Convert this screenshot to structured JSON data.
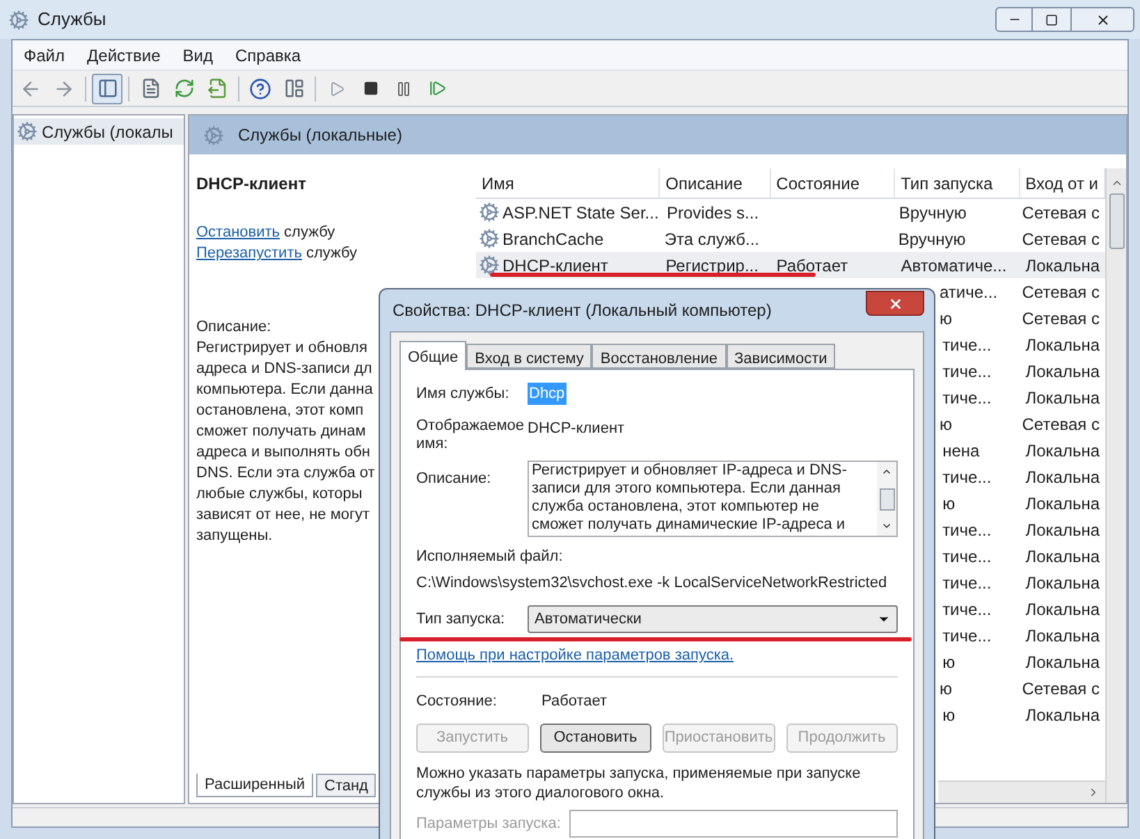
{
  "window": {
    "title": "Службы"
  },
  "menu": [
    "Файл",
    "Действие",
    "Вид",
    "Справка"
  ],
  "tree": [
    {
      "label": "Службы (локалы",
      "selected": true
    }
  ],
  "header": {
    "title": "Службы (локальные)"
  },
  "details": {
    "title": "DHCP-клиент",
    "actions": [
      {
        "link": "Остановить",
        "text": "службу"
      },
      {
        "link": "Перезапустить",
        "text": "службу"
      }
    ],
    "description_label": "Описание:",
    "description_lines": [
      "Регистрирует и обновля",
      "адреса и DNS-записи дл",
      "компьютера. Если данна",
      "остановлена, этот комп",
      "сможет получать динам",
      "адреса и выполнять обн",
      "DNS. Если эта служба от",
      "любые службы, которы",
      "зависят от нее, не могут",
      "запущены."
    ]
  },
  "view_tabs": [
    {
      "label": "Расширенный",
      "selected": true
    },
    {
      "label": "Станд",
      "selected": false
    }
  ],
  "table": {
    "columns": [
      "Имя",
      "Описание",
      "Состояние",
      "Тип запуска",
      "Вход от и"
    ],
    "rows": [
      {
        "kind": "full",
        "selected": false,
        "name": "ASP.NET State Ser...",
        "description": "Provides s...",
        "status": "",
        "start_type": "Вручную",
        "logon": "Сетевая с"
      },
      {
        "kind": "full",
        "selected": false,
        "name": "BranchCache",
        "description": "Эта служб...",
        "status": "",
        "start_type": "Вручную",
        "logon": "Сетевая с"
      },
      {
        "kind": "full",
        "selected": true,
        "name": "DHCP-клиент",
        "description": "Регистрир...",
        "status": "Работает",
        "start_type": "Автоматиче...",
        "logon": "Локальна"
      },
      {
        "kind": "covered",
        "start_type": "атиче...",
        "logon": "Сетевая с"
      },
      {
        "kind": "covered",
        "start_type": "ю",
        "logon": "Сетевая с"
      },
      {
        "kind": "covered",
        "start_type": "тиче...",
        "logon": "Локальна"
      },
      {
        "kind": "covered",
        "start_type": "тиче...",
        "logon": "Локальна"
      },
      {
        "kind": "covered",
        "start_type": "тиче...",
        "logon": "Локальна"
      },
      {
        "kind": "covered",
        "start_type": "ю",
        "logon": "Сетевая с"
      },
      {
        "kind": "covered",
        "start_type": "нена",
        "logon": "Локальна"
      },
      {
        "kind": "covered",
        "start_type": "тиче...",
        "logon": "Локальна"
      },
      {
        "kind": "covered",
        "start_type": "ю",
        "logon": "Локальна"
      },
      {
        "kind": "covered",
        "start_type": "тиче...",
        "logon": "Локальна"
      },
      {
        "kind": "covered",
        "start_type": "тиче...",
        "logon": "Локальна"
      },
      {
        "kind": "covered",
        "start_type": "тиче...",
        "logon": "Локальна"
      },
      {
        "kind": "covered",
        "start_type": "тиче...",
        "logon": "Локальна"
      },
      {
        "kind": "covered",
        "start_type": "тиче...",
        "logon": "Локальна"
      },
      {
        "kind": "covered",
        "start_type": "ю",
        "logon": "Локальна"
      },
      {
        "kind": "covered",
        "start_type": "ю",
        "logon": "Сетевая с"
      },
      {
        "kind": "covered",
        "start_type": "ю",
        "logon": "Локальна"
      }
    ]
  },
  "dialog": {
    "title": "Свойства: DHCP-клиент (Локальный компьютер)",
    "tabs": [
      {
        "label": "Общие",
        "selected": true
      },
      {
        "label": "Вход в систему",
        "selected": false
      },
      {
        "label": "Восстановление",
        "selected": false
      },
      {
        "label": "Зависимости",
        "selected": false
      }
    ],
    "service_name": {
      "label": "Имя службы:",
      "value": "Dhcp",
      "selected": true
    },
    "display_name": {
      "label_lines": [
        "Отображаемое",
        "имя:"
      ],
      "value": "DHCP-клиент"
    },
    "description": {
      "label": "Описание:",
      "lines": [
        "Регистрирует и обновляет IP-адреса и DNS-",
        "записи для этого компьютера. Если данная",
        "служба остановлена, этот компьютер не",
        "сможет получать динамические IP-адреса и"
      ]
    },
    "executable": {
      "label": "Исполняемый файл:",
      "value": "C:\\Windows\\system32\\svchost.exe -k LocalServiceNetworkRestricted"
    },
    "startup_type": {
      "label": "Тип запуска:",
      "value": "Автоматически"
    },
    "help_link": "Помощь при настройке параметров запуска.",
    "status": {
      "label": "Состояние:",
      "value": "Работает"
    },
    "buttons": [
      {
        "label": "Запустить",
        "disabled": true
      },
      {
        "label": "Остановить",
        "disabled": false
      },
      {
        "label": "Приостановить",
        "disabled": true
      },
      {
        "label": "Продолжить",
        "disabled": true
      }
    ],
    "note": "Можно указать параметры запуска, применяемые при запуске службы из этого диалогового окна.",
    "parameters": {
      "label": "Параметры запуска:",
      "disabled": true
    }
  }
}
